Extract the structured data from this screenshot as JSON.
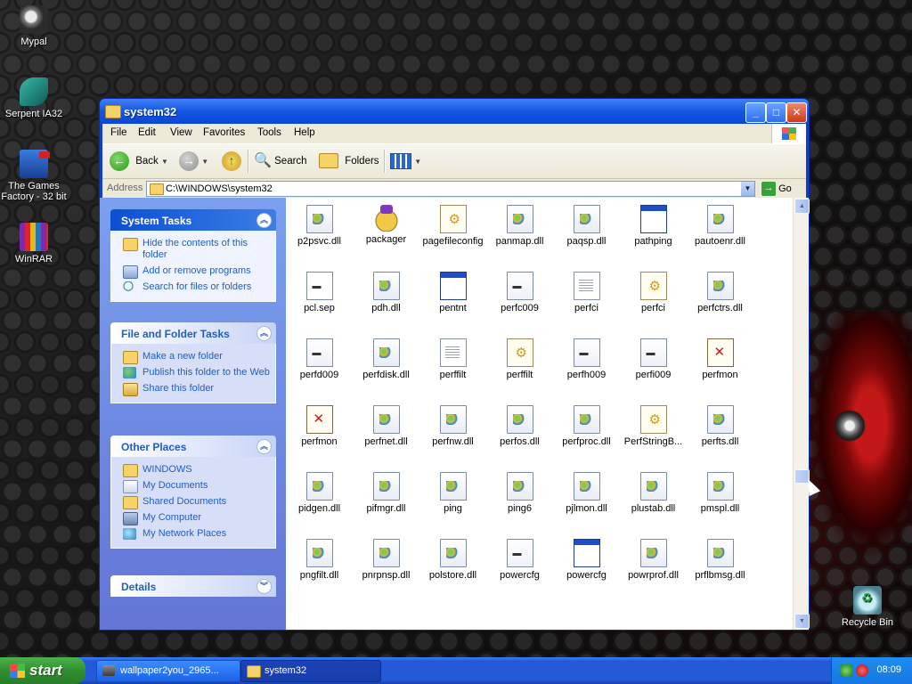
{
  "desktop": {
    "icons": [
      {
        "label": "Mypal"
      },
      {
        "label": "Serpent IA32"
      },
      {
        "label": "The Games Factory - 32 bit"
      },
      {
        "label": "WinRAR"
      },
      {
        "label": "Recycle Bin"
      }
    ]
  },
  "window": {
    "title": "system32",
    "menu": [
      "File",
      "Edit",
      "View",
      "Favorites",
      "Tools",
      "Help"
    ],
    "toolbar": {
      "back": "Back",
      "search": "Search",
      "folders": "Folders"
    },
    "address": {
      "label": "Address",
      "path": "C:\\WINDOWS\\system32",
      "go": "Go"
    }
  },
  "taskpane": {
    "system_tasks": {
      "title": "System Tasks",
      "items": [
        "Hide the contents of this folder",
        "Add or remove programs",
        "Search for files or folders"
      ]
    },
    "file_folder_tasks": {
      "title": "File and Folder Tasks",
      "items": [
        "Make a new folder",
        "Publish this folder to the Web",
        "Share this folder"
      ]
    },
    "other_places": {
      "title": "Other Places",
      "items": [
        "WINDOWS",
        "My Documents",
        "Shared Documents",
        "My Computer",
        "My Network Places"
      ]
    },
    "details": {
      "title": "Details"
    }
  },
  "files": [
    {
      "name": "p2psvc.dll",
      "icon": "dll"
    },
    {
      "name": "packager",
      "icon": "pack"
    },
    {
      "name": "pagefileconfig",
      "icon": "cfg"
    },
    {
      "name": "panmap.dll",
      "icon": "dll"
    },
    {
      "name": "paqsp.dll",
      "icon": "dll"
    },
    {
      "name": "pathping",
      "icon": "exe"
    },
    {
      "name": "pautoenr.dll",
      "icon": "dll"
    },
    {
      "name": "pcl.sep",
      "icon": "sep"
    },
    {
      "name": "pdh.dll",
      "icon": "dll"
    },
    {
      "name": "pentnt",
      "icon": "exe"
    },
    {
      "name": "perfc009",
      "icon": "file"
    },
    {
      "name": "perfci",
      "icon": "txt"
    },
    {
      "name": "perfci",
      "icon": "cfg"
    },
    {
      "name": "perfctrs.dll",
      "icon": "dll"
    },
    {
      "name": "perfd009",
      "icon": "file"
    },
    {
      "name": "perfdisk.dll",
      "icon": "dll"
    },
    {
      "name": "perffilt",
      "icon": "txt"
    },
    {
      "name": "perffilt",
      "icon": "cfg"
    },
    {
      "name": "perfh009",
      "icon": "file"
    },
    {
      "name": "perfi009",
      "icon": "file"
    },
    {
      "name": "perfmon",
      "icon": "mon"
    },
    {
      "name": "perfmon",
      "icon": "mon"
    },
    {
      "name": "perfnet.dll",
      "icon": "dll"
    },
    {
      "name": "perfnw.dll",
      "icon": "dll"
    },
    {
      "name": "perfos.dll",
      "icon": "dll"
    },
    {
      "name": "perfproc.dll",
      "icon": "dll"
    },
    {
      "name": "PerfStringB...",
      "icon": "cfg"
    },
    {
      "name": "perfts.dll",
      "icon": "dll"
    },
    {
      "name": "pidgen.dll",
      "icon": "dll"
    },
    {
      "name": "pifmgr.dll",
      "icon": "dll"
    },
    {
      "name": "ping",
      "icon": "dll"
    },
    {
      "name": "ping6",
      "icon": "dll"
    },
    {
      "name": "pjlmon.dll",
      "icon": "dll"
    },
    {
      "name": "plustab.dll",
      "icon": "dll"
    },
    {
      "name": "pmspl.dll",
      "icon": "dll"
    },
    {
      "name": "pngfilt.dll",
      "icon": "dll"
    },
    {
      "name": "pnrpnsp.dll",
      "icon": "dll"
    },
    {
      "name": "polstore.dll",
      "icon": "dll"
    },
    {
      "name": "powercfg",
      "icon": "file"
    },
    {
      "name": "powercfg",
      "icon": "exe"
    },
    {
      "name": "powrprof.dll",
      "icon": "dll"
    },
    {
      "name": "prflbmsg.dll",
      "icon": "dll"
    }
  ],
  "taskbar": {
    "start": "start",
    "tasks": [
      "wallpaper2you_2965...",
      "system32"
    ],
    "clock": "08:09"
  }
}
